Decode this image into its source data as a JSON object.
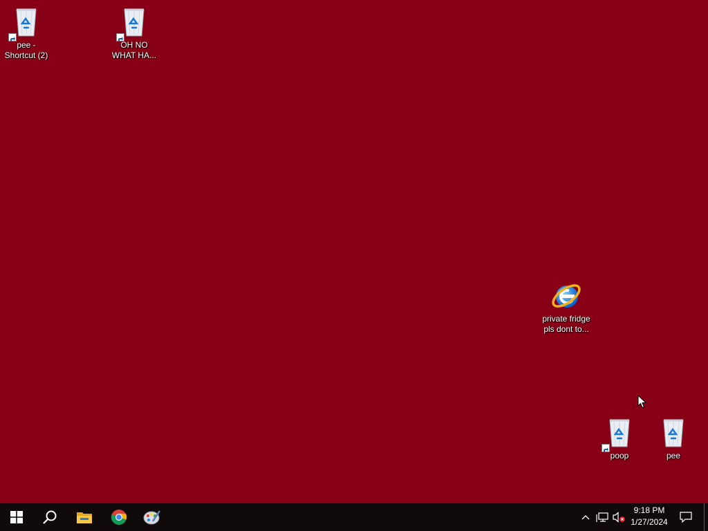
{
  "desktop": {
    "icons": [
      {
        "label": "pee -\nShortcut (2)",
        "icon": "recycle-bin-icon",
        "shortcut": true
      },
      {
        "label": "OH NO\nWHAT HA...",
        "icon": "recycle-bin-icon",
        "shortcut": true
      },
      {
        "label": "private fridge\npls dont to...",
        "icon": "internet-explorer-icon",
        "shortcut": false
      },
      {
        "label": "poop",
        "icon": "recycle-bin-icon",
        "shortcut": true
      },
      {
        "label": "pee",
        "icon": "recycle-bin-icon",
        "shortcut": false
      }
    ],
    "background_color": "#880016"
  },
  "taskbar": {
    "pinned": [
      "start-icon",
      "search-icon",
      "file-explorer-icon",
      "chrome-icon",
      "paint-icon"
    ],
    "tray": {
      "time": "9:18 PM",
      "date": "1/27/2024",
      "icons": [
        "chevron-up-icon",
        "network-icon",
        "volume-muted-icon",
        "notification-icon"
      ]
    }
  }
}
